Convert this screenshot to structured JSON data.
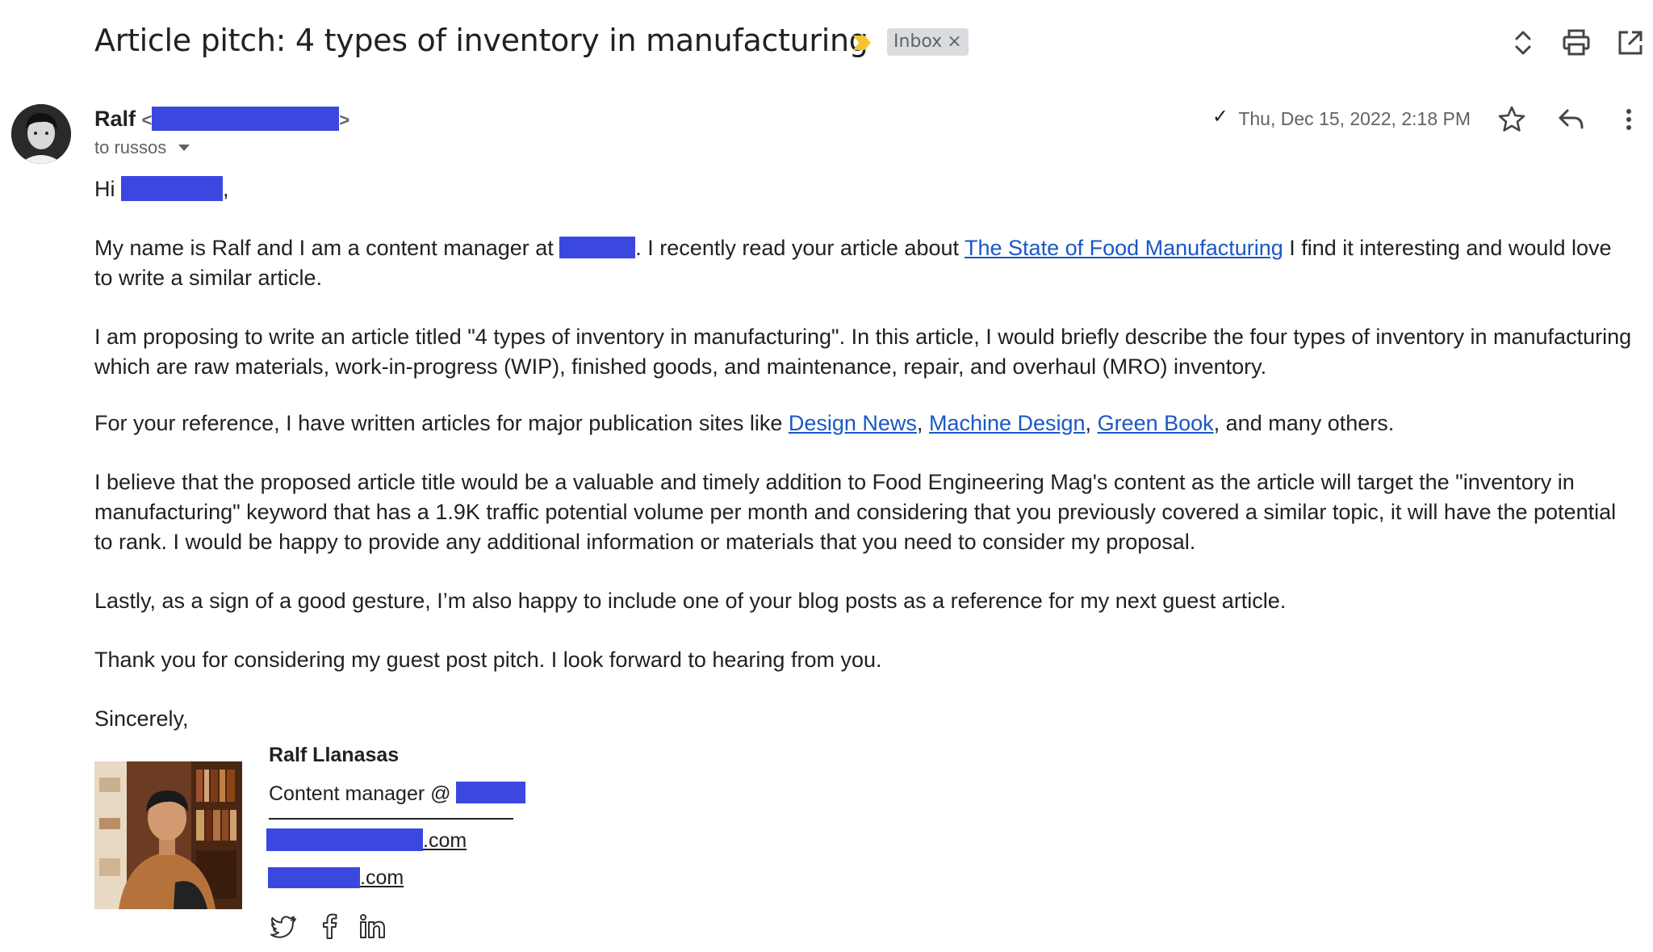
{
  "header": {
    "subject": "Article pitch: 4 types of inventory in manufacturing",
    "label_chip": "Inbox",
    "label_remove": "×",
    "icons": [
      "importance-marker-icon",
      "expand-collapse-icon",
      "print-icon",
      "open-new-window-icon"
    ]
  },
  "message": {
    "sender_name": "Ralf",
    "sender_email_open": "<",
    "sender_email_close": ">",
    "to_line": "to russos",
    "check_mark": "✓",
    "date": "Thu, Dec 15, 2022, 2:18 PM",
    "icons": [
      "star-icon",
      "reply-icon",
      "more-vert-icon",
      "dropdown-caret-icon"
    ],
    "greeting_hi": "Hi",
    "greeting_comma": ",",
    "p1_a": "My name is Ralf and I am a content manager at",
    "p1_b": ". I recently read your article about ",
    "p1_link": "The State of Food Manufacturing",
    "p1_c": " I find it interesting and would love to write a similar article.",
    "p2": "I am proposing to write an article titled \"4 types of inventory in manufacturing\". In this article, I would briefly describe the four types of inventory in manufacturing which are raw materials, work-in-progress (WIP), finished goods, and maintenance, repair, and overhaul (MRO) inventory.",
    "p3_a": "For your reference, I have written articles for major publication sites like ",
    "p3_link1": "Design News",
    "p3_sep1": ", ",
    "p3_link2": "Machine Design",
    "p3_sep2": ", ",
    "p3_link3": "Green Book",
    "p3_b": ", and many others.",
    "p4": "I believe that the proposed article title would be a valuable and timely addition to Food Engineering Mag's content as the article will target the \"inventory in manufacturing\" keyword that has a 1.9K traffic potential volume per month and considering that you previously covered a similar topic, it will have the potential to rank.  I would be happy to provide any additional information or materials that you need to consider my proposal.",
    "p5": "Lastly, as a sign of a good gesture, I’m also happy to include one of your blog posts as a reference for my next guest article.",
    "p6": "Thank you for considering my guest post pitch. I look forward to hearing from you.",
    "closing": "Sincerely,"
  },
  "signature": {
    "name": "Ralf Llanasas",
    "role": "Content manager @ ",
    "link1_suffix": ".com",
    "link2_suffix": ".com",
    "social_icons": [
      "twitter-icon",
      "facebook-icon",
      "linkedin-icon"
    ]
  },
  "colors": {
    "redaction": "#3b48e0",
    "link": "#1a57c8",
    "importance_marker": "#f4c430",
    "chip_bg": "#dadce0"
  }
}
